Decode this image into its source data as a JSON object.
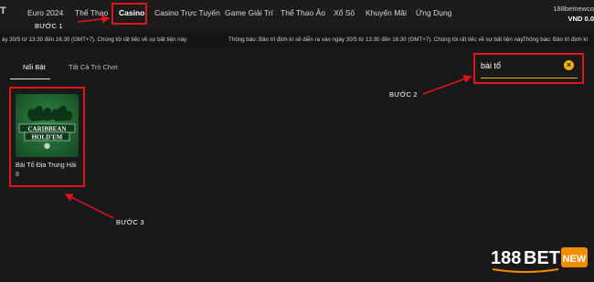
{
  "header": {
    "logo_fragment": "T",
    "nav": [
      {
        "label": "Euro 2024"
      },
      {
        "label": "Thể Thao"
      },
      {
        "label": "Casino",
        "active": true
      },
      {
        "label": "Casino Trực Tuyến"
      },
      {
        "label": "Game Giải Trí"
      },
      {
        "label": "Thể Thao Ảo"
      },
      {
        "label": "Xổ Số"
      },
      {
        "label": "Khuyến Mãi"
      },
      {
        "label": "Ứng Dụng"
      }
    ],
    "account_name": "188betnewco",
    "balance": "VND 0.0"
  },
  "ticker": {
    "segment_1": "ày 30/5 từ 13:30 đến 16:30 (GMT+7). Chúng tôi rất tiếc về sự bất tiện này.",
    "segment_2": "Thông báo: Bảo trì định kì sẽ diễn ra vào ngày 30/5 từ 13:30 đến 16:30 (GMT+7). Chúng tôi rất tiếc về sự bất tiện này.",
    "segment_3": "Thông báo: Bảo trì định kì"
  },
  "tabs": [
    {
      "label": "Nổi Bật",
      "active": true
    },
    {
      "label": "Tất Cả Trò Chơi"
    }
  ],
  "search": {
    "value": "bài tổ",
    "clear_icon": "close-circle-icon"
  },
  "results": [
    {
      "title": "Bài Tố Địa Trung Hải II",
      "thumb_text_1": "CARIBBEAN",
      "thumb_text_2": "HOLD'EM"
    }
  ],
  "annotations": {
    "step1": "BƯỚC 1",
    "step2": "BƯỚC 2",
    "step3": "BƯỚC 3",
    "highlight_color": "#e0151b"
  },
  "brand": {
    "part1": "188",
    "part2": "BET",
    "part3": "NEW"
  },
  "colors": {
    "accent": "#f0b400",
    "background": "#191919",
    "thumb_green": "#1d6b33"
  }
}
